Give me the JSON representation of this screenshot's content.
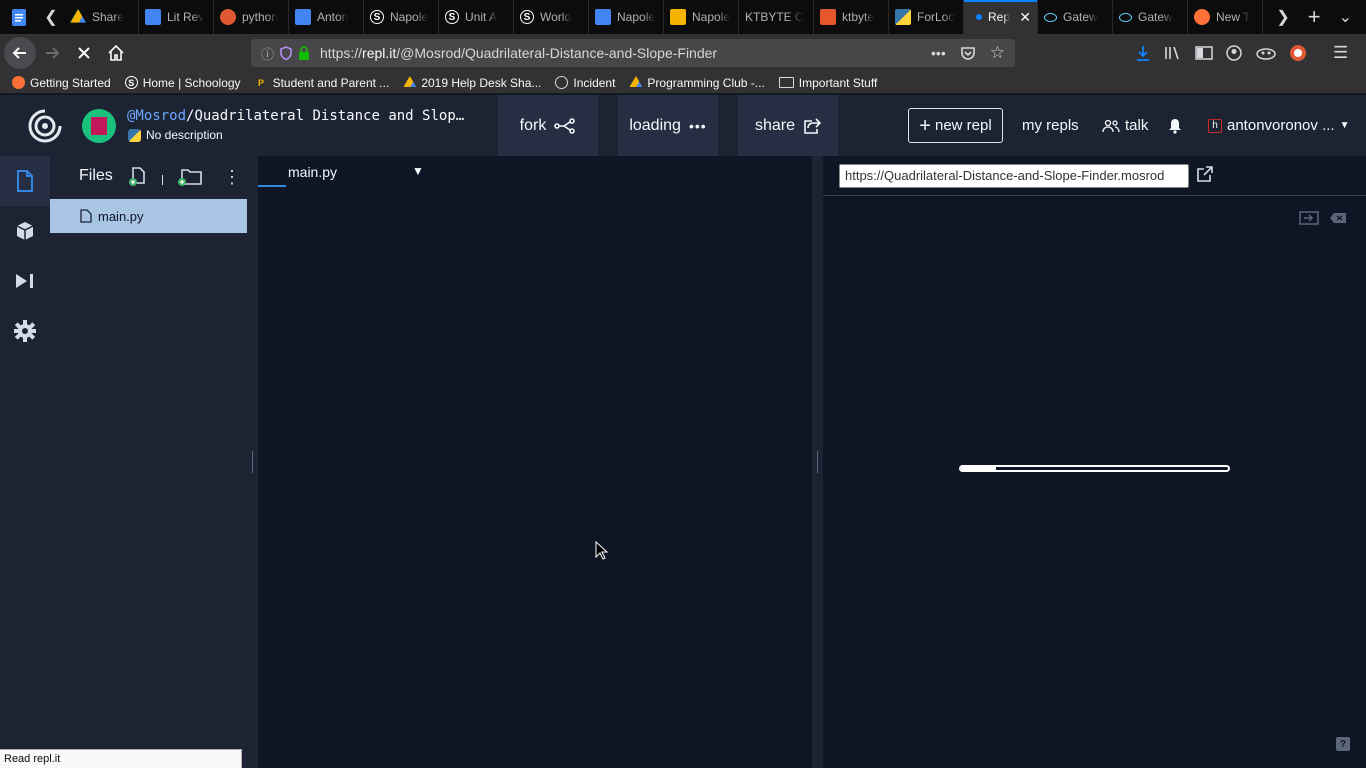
{
  "browser": {
    "tabs": [
      {
        "title": "Share",
        "icon": "google-drive-icon",
        "color": "#4285f4"
      },
      {
        "title": "Lit Rev",
        "icon": "google-docs-icon",
        "color": "#4285f4"
      },
      {
        "title": "python",
        "icon": "duckduckgo-icon",
        "color": "#de5833"
      },
      {
        "title": "Anton",
        "icon": "google-docs-icon",
        "color": "#4285f4"
      },
      {
        "title": "Napole",
        "icon": "schoology-icon",
        "color": "#ffffff"
      },
      {
        "title": "Unit A",
        "icon": "schoology-icon",
        "color": "#ffffff"
      },
      {
        "title": "World",
        "icon": "schoology-icon",
        "color": "#ffffff"
      },
      {
        "title": "Napole",
        "icon": "google-docs-icon",
        "color": "#4285f4"
      },
      {
        "title": "Napole",
        "icon": "google-slides-icon",
        "color": "#f4b400"
      },
      {
        "title": "KTBYTE C",
        "icon": "none",
        "color": ""
      },
      {
        "title": "ktbyte",
        "icon": "ktbyte-icon",
        "color": "#e8572b"
      },
      {
        "title": "ForLoo",
        "icon": "python-icon",
        "color": "#3776ab"
      },
      {
        "title": "Rep",
        "icon": "loading-dot-icon",
        "color": "#0a84ff",
        "active": true
      },
      {
        "title": "Gatew",
        "icon": "react-icon",
        "color": "#61dafb"
      },
      {
        "title": "Gatew",
        "icon": "react-icon",
        "color": "#61dafb"
      },
      {
        "title": "New T",
        "icon": "firefox-icon",
        "color": "#ff7139"
      }
    ],
    "url_prefix": "https://",
    "url_domain": "repl.it",
    "url_path": "/@Mosrod/Quadrilateral-Distance-and-Slope-Finder",
    "bookmarks": [
      {
        "label": "Getting Started",
        "icon": "firefox-icon"
      },
      {
        "label": "Home | Schoology",
        "icon": "schoology-icon"
      },
      {
        "label": "Student and Parent ...",
        "icon": "powerschool-icon"
      },
      {
        "label": "2019 Help Desk Sha...",
        "icon": "google-drive-icon"
      },
      {
        "label": "Incident",
        "icon": "globe-icon"
      },
      {
        "label": "Programming Club -...",
        "icon": "google-drive-icon"
      },
      {
        "label": "Important Stuff",
        "icon": "folder-icon"
      }
    ],
    "status_text": "Read repl.it"
  },
  "repl": {
    "owner": "@Mosrod",
    "separator": "/",
    "name": "Quadrilateral Distance and Slop…",
    "description": "No description",
    "fork_label": "fork",
    "loading_label": "loading",
    "share_label": "share",
    "new_repl_label": "new repl",
    "my_repls_label": "my repls",
    "talk_label": "talk",
    "username": "antonvoronov ...",
    "files_title": "Files",
    "file_name": "main.py",
    "editor_tab": "main.py",
    "output_url": "https://Quadrilateral-Distance-and-Slope-Finder.mosrod",
    "loading_progress": 0.13,
    "help_label": "?"
  }
}
